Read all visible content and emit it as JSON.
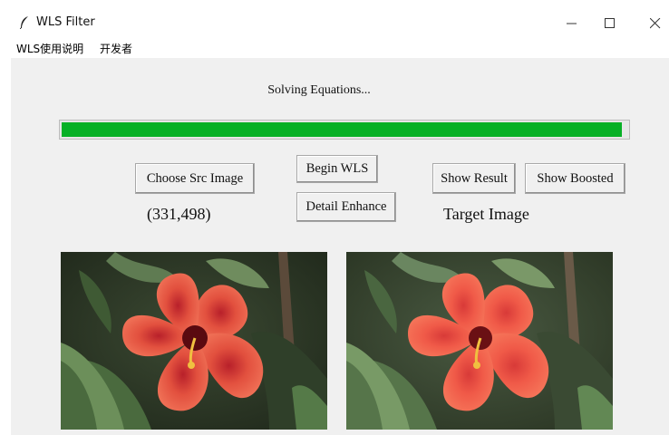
{
  "window": {
    "title": "WLS Filter",
    "icon": "feather-icon"
  },
  "menubar": {
    "items": [
      "WLS使用说明",
      "开发者"
    ]
  },
  "status": {
    "text": "Solving Equations..."
  },
  "progress": {
    "value": 0.99,
    "color": "#06b025"
  },
  "buttons": {
    "choose_src": "Choose Src Image",
    "begin_wls": "Begin WLS",
    "detail_enhance": "Detail Enhance",
    "show_result": "Show Result",
    "show_boosted": "Show Boosted"
  },
  "source": {
    "coords": "(331,498)"
  },
  "target": {
    "label": "Target Image"
  },
  "images": {
    "source_desc_icon": "hibiscus-photo",
    "target_desc_icon": "hibiscus-photo-smoothed"
  }
}
